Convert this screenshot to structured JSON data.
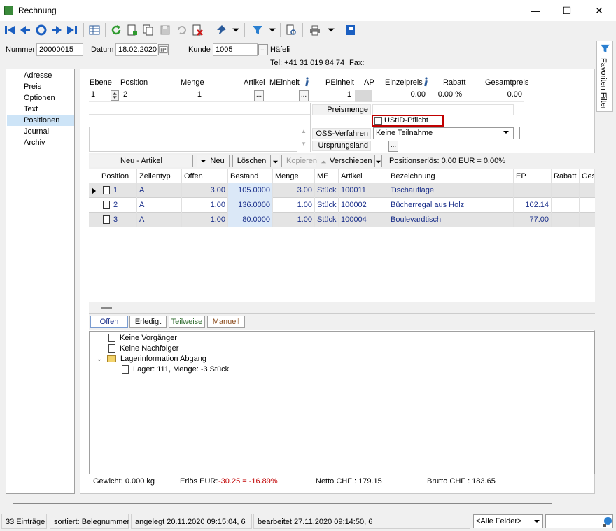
{
  "window": {
    "title": "Rechnung",
    "minimize": "—",
    "maximize": "☐",
    "close": "✕"
  },
  "header": {
    "nummer_label": "Nummer",
    "nummer_value": "20000015",
    "datum_label": "Datum",
    "datum_value": "18.02.2020",
    "kunde_label": "Kunde",
    "kunde_value": "1005",
    "kunde_name": "Häfeli",
    "tel": "Tel: +41 31 019 84 74",
    "fax": "Fax:"
  },
  "favoriten": "Favoriten Filter",
  "nav": [
    "Adresse",
    "Preis",
    "Optionen",
    "Text",
    "Positionen",
    "Journal",
    "Archiv"
  ],
  "nav_selected": 4,
  "entry": {
    "labels": [
      "Ebene",
      "Position",
      "Menge",
      "Artikel",
      "MEinheit",
      "PEinheit",
      "AP",
      "Einzelpreis",
      "Rabatt",
      "Gesamtpreis"
    ],
    "ebene": "1",
    "position": "2",
    "menge": "1",
    "peinheit": "1",
    "einzelpreis": "0.00",
    "rabatt": "0.00 %",
    "gesamtpreis": "0.00",
    "preismenge_label": "Preismenge",
    "ustid_label": "UStID-Pflicht",
    "oss_label": "OSS-Verfahren",
    "oss_value": "Keine Teilnahme",
    "ursprung_label": "Ursprungsland"
  },
  "buttons": {
    "neu_artikel": "Neu - Artikel",
    "neu": "Neu",
    "loeschen": "Löschen",
    "kopieren": "Kopieren",
    "verschieben": "Verschieben",
    "positionserloes": "Positionserlös:  0.00 EUR = 0.00%"
  },
  "grid": {
    "columns": [
      "Position",
      "Zeilentyp",
      "Offen",
      "Bestand",
      "Menge",
      "ME",
      "Artikel",
      "Bezeichnung",
      "EP",
      "Rabatt",
      "Ges"
    ],
    "rows": [
      {
        "position": "1",
        "zeilentyp": "A",
        "offen": "3.00",
        "bestand": "105.0000",
        "menge": "3.00",
        "me": "Stück",
        "artikel": "100011",
        "bezeichnung": "Tischauflage",
        "ep": "",
        "rabatt": ""
      },
      {
        "position": "2",
        "zeilentyp": "A",
        "offen": "1.00",
        "bestand": "136.0000",
        "menge": "1.00",
        "me": "Stück",
        "artikel": "100002",
        "bezeichnung": "Bücherregal aus Holz",
        "ep": "102.14",
        "rabatt": ""
      },
      {
        "position": "3",
        "zeilentyp": "A",
        "offen": "1.00",
        "bestand": "80.0000",
        "menge": "1.00",
        "me": "Stück",
        "artikel": "100004",
        "bezeichnung": "Boulevardtisch",
        "ep": "77.00",
        "rabatt": ""
      }
    ]
  },
  "tabs": [
    "Offen",
    "Erledigt",
    "Teilweise",
    "Manuell"
  ],
  "tree": {
    "vorgaenger": "Keine Vorgänger",
    "nachfolger": "Keine Nachfolger",
    "lager": "Lagerinformation Abgang",
    "lager_detail": "Lager: 111, Menge: -3 Stück"
  },
  "footer": {
    "gewicht": "Gewicht:  0.000 kg",
    "erloes_label": "Erlös EUR:",
    "erloes_value": "-30.25 = -16.89%",
    "netto": "Netto CHF :  179.15",
    "brutto": "Brutto CHF :  183.65"
  },
  "status": {
    "eintraege": "33 Einträge",
    "sortiert": "sortiert: Belegnummer",
    "angelegt": "angelegt 20.11.2020 09:15:04,  6",
    "bearbeitet": "bearbeitet 27.11.2020 09:14:50,  6",
    "felder": "<Alle Felder>"
  },
  "colors": {
    "navy": "#1a2f8a",
    "selection": "#cde4f7",
    "erloes_red": "#c00000",
    "ustid_border": "#c00000"
  }
}
